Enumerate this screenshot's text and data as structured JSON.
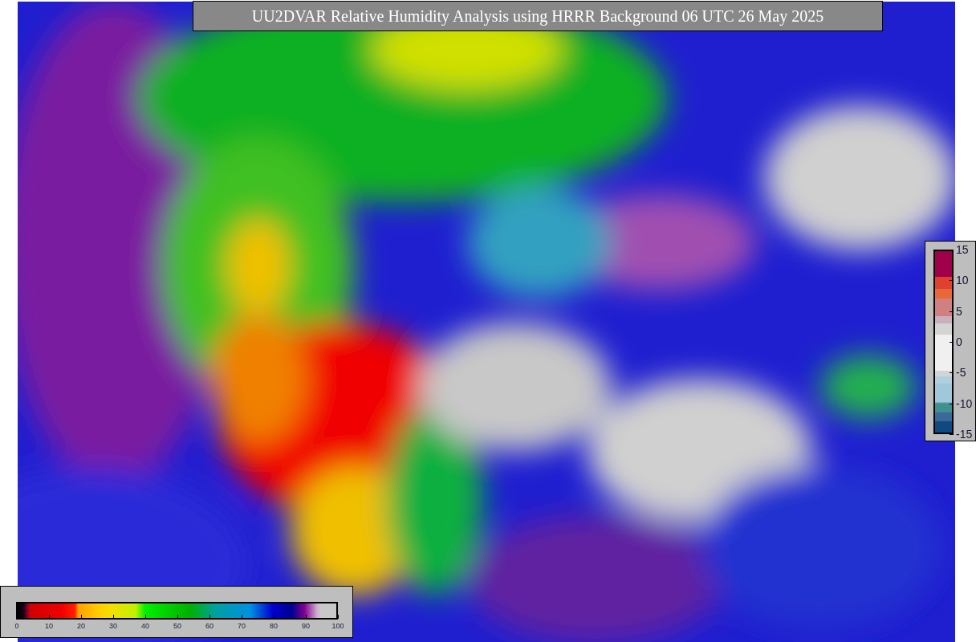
{
  "title": "UU2DVAR Relative Humidity Analysis using HRRR Background 06 UTC 26 May 2025",
  "humidity_colorbar": {
    "ticks": [
      "0",
      "10",
      "20",
      "30",
      "40",
      "50",
      "60",
      "70",
      "80",
      "90",
      "100"
    ]
  },
  "difference_colorbar": {
    "ticks": [
      "15",
      "10",
      "5",
      "0",
      "-5",
      "-10",
      "-15"
    ]
  }
}
